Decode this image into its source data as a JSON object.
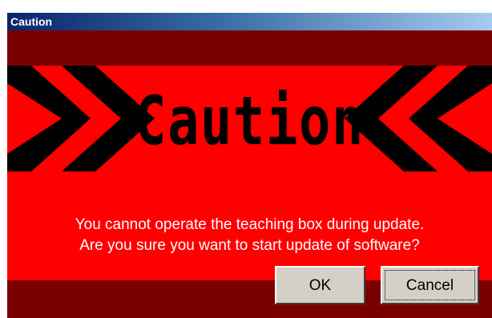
{
  "window": {
    "title": "Caution"
  },
  "banner": {
    "heading": "Caution",
    "message_line1": "You cannot operate the teaching box during update.",
    "message_line2": "Are you sure you want to start update of software?"
  },
  "buttons": {
    "ok_label": "OK",
    "cancel_label": "Cancel"
  },
  "colors": {
    "banner": "#ff0000",
    "background": "#7a0000",
    "chevron": "#000000",
    "message_text": "#ffffff"
  },
  "icons": [
    "chevron-right-arrows",
    "chevron-left-arrows"
  ]
}
